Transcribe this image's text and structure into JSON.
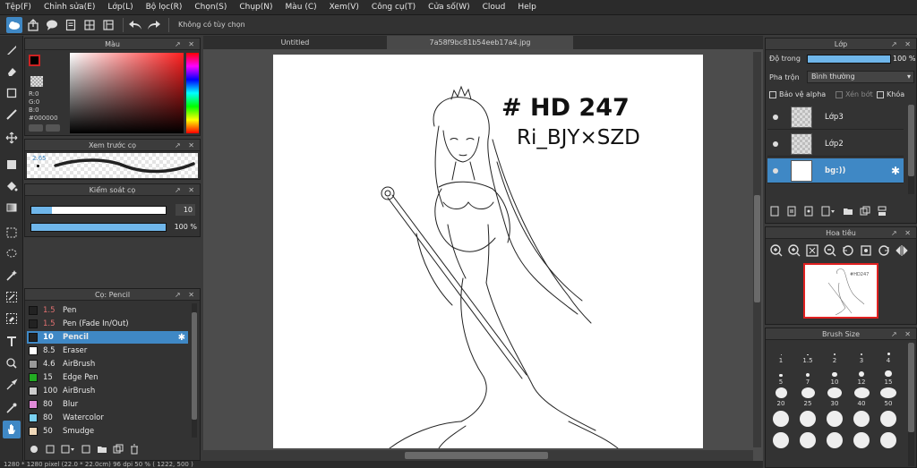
{
  "menu": [
    "Tệp(F)",
    "Chỉnh sửa(E)",
    "Lớp(L)",
    "Bộ lọc(R)",
    "Chọn(S)",
    "Chụp(N)",
    "Màu (C)",
    "Xem(V)",
    "Công cụ(T)",
    "Cửa số(W)",
    "Cloud",
    "Help"
  ],
  "toolbar": {
    "status": "Không có tùy chọn"
  },
  "color_panel": {
    "title": "Màu",
    "r": "R:0",
    "g": "G:0",
    "b": "B:0",
    "hex": "#000000",
    "foreground": "#000000",
    "accent": "#cc2222"
  },
  "preview_panel": {
    "title": "Xem trước cọ",
    "size": "2.65"
  },
  "control_panel": {
    "title": "Kiểm soát cọ",
    "size_value": "10",
    "size_fill": 0.15,
    "opacity_value": "100 %",
    "opacity_fill": 1.0
  },
  "brush_panel": {
    "title": "Cọ: Pencil",
    "items": [
      {
        "size": "1.5",
        "name": "Pen",
        "color": "#222222",
        "size_color": "#e07070"
      },
      {
        "size": "1.5",
        "name": "Pen (Fade In/Out)",
        "color": "#222222",
        "size_color": "#e07070"
      },
      {
        "size": "10",
        "name": "Pencil",
        "color": "#222222",
        "size_color": "#ffffff"
      },
      {
        "size": "8.5",
        "name": "Eraser",
        "color": "#ffffff",
        "size_color": "#e8e8e8"
      },
      {
        "size": "4.6",
        "name": "AirBrush",
        "color": "#999999",
        "size_color": "#e8e8e8"
      },
      {
        "size": "15",
        "name": "Edge Pen",
        "color": "#22aa22",
        "size_color": "#e8e8e8"
      },
      {
        "size": "100",
        "name": "AirBrush",
        "color": "#cccccc",
        "size_color": "#e8e8e8"
      },
      {
        "size": "80",
        "name": "Blur",
        "color": "#e08ad8",
        "size_color": "#e8e8e8"
      },
      {
        "size": "80",
        "name": "Watercolor",
        "color": "#7ad0f0",
        "size_color": "#e8e8e8"
      },
      {
        "size": "50",
        "name": "Smudge",
        "color": "#f0d8b8",
        "size_color": "#e8e8e8"
      }
    ]
  },
  "tabs": [
    "Untitled",
    "7a58f9bc81b54eeb17a4.jpg"
  ],
  "canvas_text": {
    "line1": "# HD 247",
    "line2": "Ri_BJY×SZD"
  },
  "statusbar": "1280 * 1280 pixel  (22.0 * 22.0cm)  96 dpi  50 %  ( 1222, 500 )",
  "layer_panel": {
    "title": "Lớp",
    "opacity_label": "Độ trong",
    "opacity_value": "100 %",
    "opacity_fill": 1.0,
    "blend_label": "Pha trộn",
    "blend_value": "Bình thường",
    "protect_alpha": "Bảo vệ alpha",
    "clipping": "Xén bớt",
    "lock": "Khóa",
    "layers": [
      {
        "name": "Lớp3",
        "selected": false
      },
      {
        "name": "Lớp2",
        "selected": false
      },
      {
        "name": "bg:))",
        "selected": true
      }
    ]
  },
  "navigator_panel": {
    "title": "Hoa tiêu"
  },
  "brushsize_panel": {
    "title": "Brush Size",
    "sizes": [
      "1",
      "1.5",
      "2",
      "3",
      "4",
      "5",
      "7",
      "10",
      "12",
      "15",
      "20",
      "25",
      "30",
      "40",
      "50"
    ]
  }
}
